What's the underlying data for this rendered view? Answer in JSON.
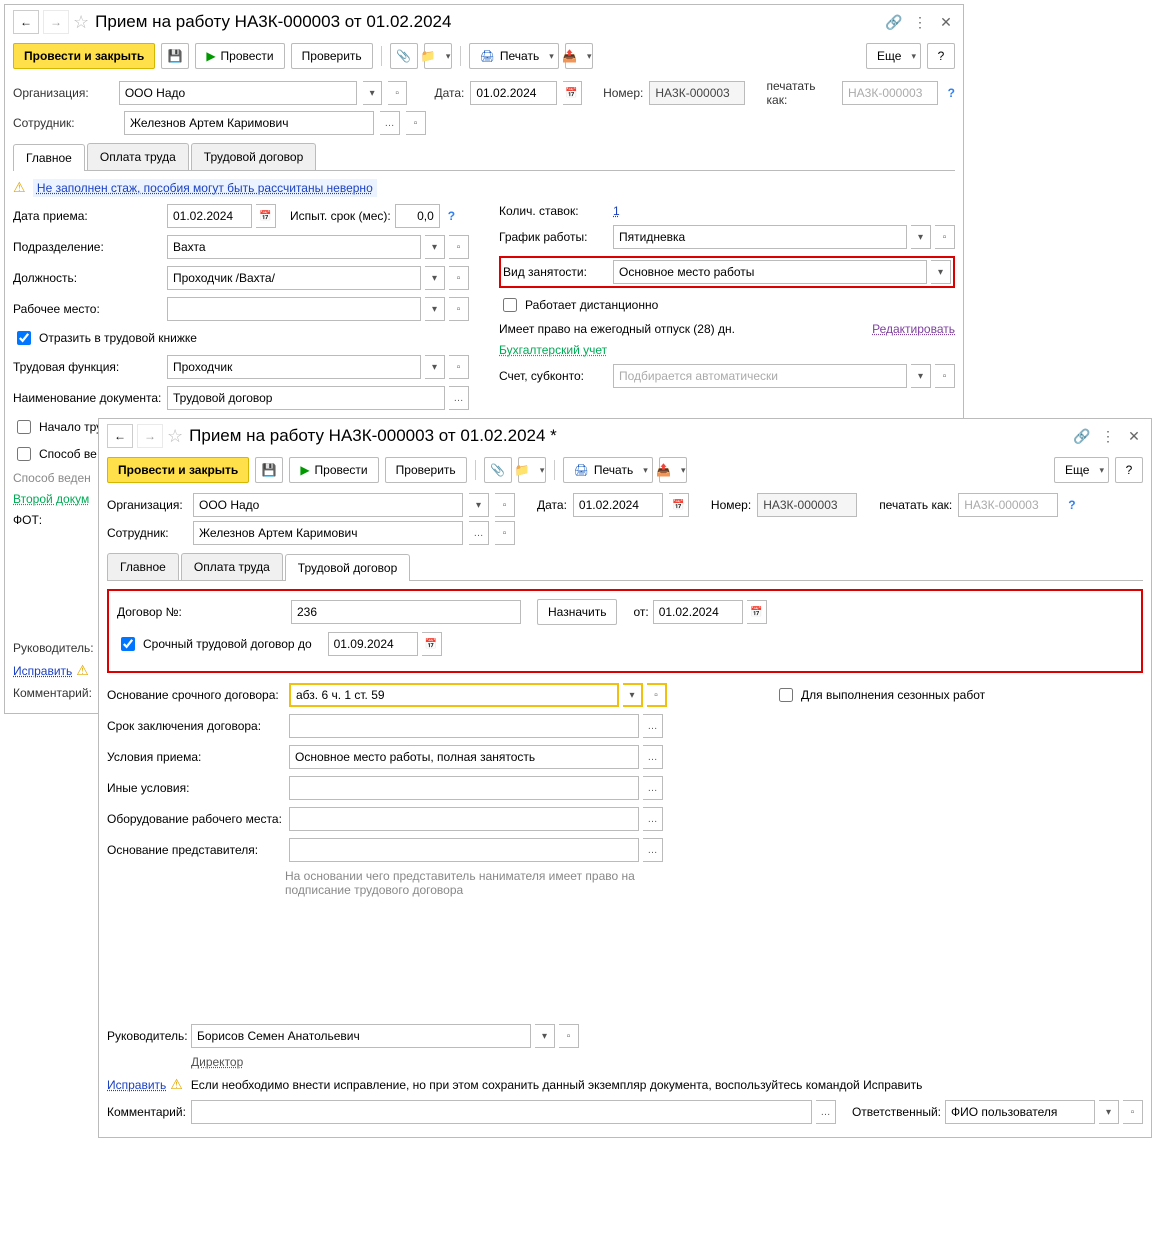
{
  "win1": {
    "title": "Прием на работу НА3К-000003 от 01.02.2024",
    "toolbar": {
      "post_close": "Провести и закрыть",
      "post": "Провести",
      "check": "Проверить",
      "print": "Печать",
      "more": "Еще"
    },
    "header": {
      "org_label": "Организация:",
      "org_value": "ООО Надо",
      "date_label": "Дата:",
      "date_value": "01.02.2024",
      "number_label": "Номер:",
      "number_value": "НА3К-000003",
      "print_as_label": "печатать как:",
      "print_as_placeholder": "НА3К-000003",
      "emp_label": "Сотрудник:",
      "emp_value": "Железнов Артем Каримович"
    },
    "tabs": {
      "main": "Главное",
      "pay": "Оплата труда",
      "contract": "Трудовой договор"
    },
    "warning": "Не заполнен стаж, пособия могут быть рассчитаны неверно",
    "left": {
      "date_label": "Дата приема:",
      "date_value": "01.02.2024",
      "probation_label": "Испыт. срок (мес):",
      "probation_value": "0,0",
      "dept_label": "Подразделение:",
      "dept_value": "Вахта",
      "pos_label": "Должность:",
      "pos_value": "Проходчик /Вахта/",
      "place_label": "Рабочее место:",
      "book_label": "Отразить в трудовой книжке",
      "func_label": "Трудовая функция:",
      "func_value": "Проходчик",
      "docname_label": "Наименование документа:",
      "docname_value": "Трудовой договор",
      "first_job": "Начало трудовой деятельности (ранее нигде не был трудоустроен)",
      "method": "Способ ве",
      "method2": "Способ веден",
      "second_doc": "Второй докум",
      "fot_label": "ФОТ:"
    },
    "right": {
      "rates_label": "Колич. ставок:",
      "rates_value": "1",
      "schedule_label": "График работы:",
      "schedule_value": "Пятидневка",
      "emptype_label": "Вид занятости:",
      "emptype_value": "Основное место работы",
      "remote": "Работает дистанционно",
      "vacation": "Имеет право на ежегодный отпуск (28) дн.",
      "edit": "Редактировать",
      "acc_header": "Бухгалтерский учет",
      "account_label": "Счет, субконто:",
      "account_placeholder": "Подбирается автоматически"
    },
    "footer": {
      "head_label": "Руководитель:",
      "fix": "Исправить",
      "comment_label": "Комментарий:"
    }
  },
  "win2": {
    "title": "Прием на работу НА3К-000003 от 01.02.2024 *",
    "toolbar": {
      "post_close": "Провести и закрыть",
      "post": "Провести",
      "check": "Проверить",
      "print": "Печать",
      "more": "Еще"
    },
    "header": {
      "org_label": "Организация:",
      "org_value": "ООО Надо",
      "date_label": "Дата:",
      "date_value": "01.02.2024",
      "number_label": "Номер:",
      "number_value": "НА3К-000003",
      "print_as_label": "печатать как:",
      "print_as_placeholder": "НА3К-000003",
      "emp_label": "Сотрудник:",
      "emp_value": "Железнов Артем Каримович"
    },
    "tabs": {
      "main": "Главное",
      "pay": "Оплата труда",
      "contract": "Трудовой договор"
    },
    "contract": {
      "num_label": "Договор №:",
      "num_value": "236",
      "assign": "Назначить",
      "from_label": "от:",
      "from_value": "01.02.2024",
      "fixed_label": "Срочный трудовой договор до",
      "fixed_value": "01.09.2024",
      "basis_label": "Основание срочного договора:",
      "basis_value": "абз. 6 ч. 1 ст. 59",
      "seasonal": "Для выполнения сезонных работ",
      "term_label": "Срок заключения договора:",
      "cond_label": "Условия приема:",
      "cond_value": "Основное место работы, полная занятость",
      "other_label": "Иные условия:",
      "equip_label": "Оборудование рабочего места:",
      "rep_label": "Основание представителя:",
      "rep_hint": "На основании чего представитель нанимателя имеет право на подписание трудового договора"
    },
    "footer": {
      "head_label": "Руководитель:",
      "head_value": "Борисов Семен Анатольевич",
      "director": "Директор",
      "fix": "Исправить",
      "fix_hint": "Если необходимо внести исправление, но при этом сохранить данный экземпляр документа, воспользуйтесь командой Исправить",
      "comment_label": "Комментарий:",
      "resp_label": "Ответственный:",
      "resp_value": "ФИО пользователя"
    }
  }
}
